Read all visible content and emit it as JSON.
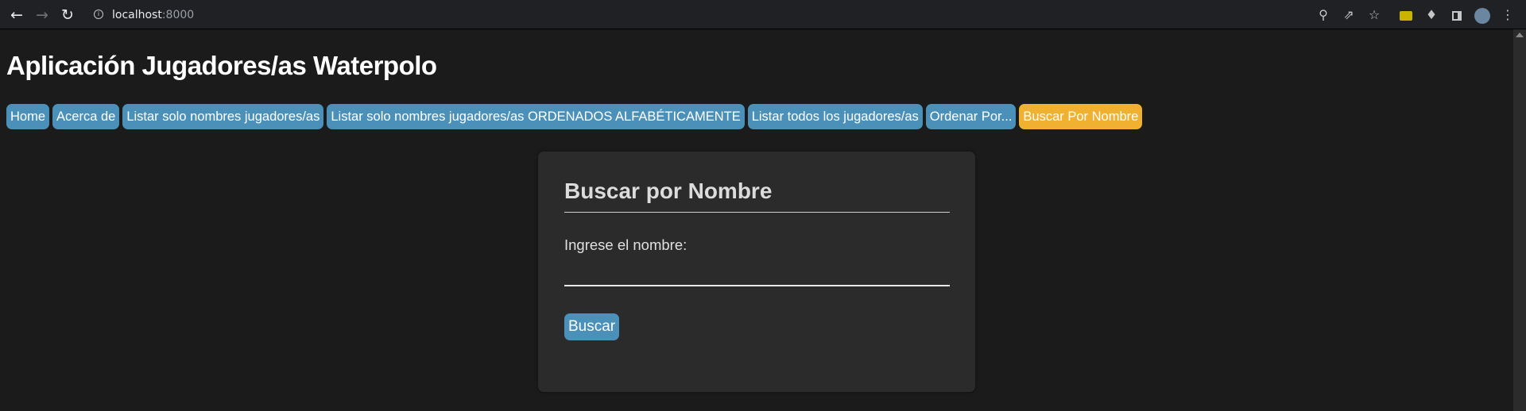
{
  "browser": {
    "url_host": "localhost",
    "url_port": ":8000"
  },
  "page": {
    "title": "Aplicación Jugadores/as Waterpolo"
  },
  "nav": {
    "items": [
      {
        "label": "Home"
      },
      {
        "label": "Acerca de"
      },
      {
        "label": "Listar solo nombres jugadores/as"
      },
      {
        "label": "Listar solo nombres jugadores/as ORDENADOS ALFABÉTICAMENTE"
      },
      {
        "label": "Listar todos los jugadores/as"
      },
      {
        "label": "Ordenar Por..."
      },
      {
        "label": "Buscar Por Nombre"
      }
    ],
    "active_index": 6
  },
  "search_form": {
    "heading": "Buscar por Nombre",
    "field_label": "Ingrese el nombre:",
    "field_value": "",
    "submit_label": "Buscar"
  },
  "colors": {
    "background": "#1b1b1b",
    "nav_button": "#4a90b8",
    "nav_active": "#f0b030",
    "card": "#2b2b2b"
  },
  "icons": {
    "back": "back-arrow-icon",
    "forward": "forward-arrow-icon",
    "reload": "reload-icon",
    "site_info": "info-icon",
    "zoom": "zoom-icon",
    "share": "share-icon",
    "bookmark": "star-icon",
    "extension": "extension-icon",
    "extensions_menu": "puzzle-icon",
    "side_panel": "side-panel-icon",
    "profile": "avatar-icon",
    "menu": "kebab-menu-icon"
  }
}
